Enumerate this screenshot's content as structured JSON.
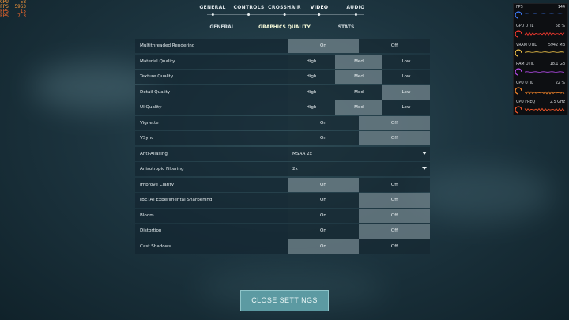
{
  "osd": [
    {
      "k": "GPU",
      "v": "58",
      "color": "#ff9b3a"
    },
    {
      "k": "FPS",
      "v": "5963",
      "color": "#ff9b3a"
    },
    {
      "k": "FPS",
      "v": "15",
      "color": "#ff6a2a"
    },
    {
      "k": "FPS",
      "v": "7.3",
      "color": "#ff6a2a"
    }
  ],
  "tabs": [
    "GENERAL",
    "CONTROLS",
    "CROSSHAIR",
    "VIDEO",
    "AUDIO"
  ],
  "active_tab": "VIDEO",
  "subtabs": [
    "GENERAL",
    "GRAPHICS QUALITY",
    "STATS"
  ],
  "active_subtab": "GRAPHICS QUALITY",
  "settings": [
    {
      "label": "Multithreaded Rendering",
      "options": [
        "On",
        "Off"
      ],
      "selected": 0
    },
    {
      "label": "Material Quality",
      "options": [
        "High",
        "Med",
        "Low"
      ],
      "selected": 1
    },
    {
      "label": "Texture Quality",
      "options": [
        "High",
        "Med",
        "Low"
      ],
      "selected": 1
    },
    {
      "label": "Detail Quality",
      "options": [
        "High",
        "Med",
        "Low"
      ],
      "selected": 2
    },
    {
      "label": "UI Quality",
      "options": [
        "High",
        "Med",
        "Low"
      ],
      "selected": 1
    },
    {
      "label": "Vignette",
      "options": [
        "On",
        "Off"
      ],
      "selected": 1
    },
    {
      "label": "VSync",
      "options": [
        "On",
        "Off"
      ],
      "selected": 1
    },
    {
      "label": "Anti-Aliasing",
      "dropdown": "MSAA 2x"
    },
    {
      "label": "Anisotropic Filtering",
      "dropdown": "2x"
    },
    {
      "label": "Improve Clarity",
      "options": [
        "On",
        "Off"
      ],
      "selected": 0
    },
    {
      "label": "[BETA] Experimental Sharpening",
      "options": [
        "On",
        "Off"
      ],
      "selected": 1
    },
    {
      "label": "Bloom",
      "options": [
        "On",
        "Off"
      ],
      "selected": 1
    },
    {
      "label": "Distortion",
      "options": [
        "On",
        "Off"
      ],
      "selected": 1
    },
    {
      "label": "Cast Shadows",
      "options": [
        "On",
        "Off"
      ],
      "selected": 0
    }
  ],
  "close_label": "CLOSE SETTINGS",
  "monitor": [
    {
      "name": "FPS",
      "value": "144",
      "color": "#3f7fff",
      "level": 0.9
    },
    {
      "name": "GPU UTIL",
      "value": "58 %",
      "color": "#ff3b30",
      "level": 0.58
    },
    {
      "name": "VRAM UTIL",
      "value": "5942 MB",
      "color": "#f6c84a",
      "level": 0.72
    },
    {
      "name": "RAM UTIL",
      "value": "18.1 GB",
      "color": "#b84cf0",
      "level": 0.56
    },
    {
      "name": "CPU UTIL",
      "value": "22 %",
      "color": "#ff8a2a",
      "level": 0.22
    },
    {
      "name": "CPU FREQ",
      "value": "2.5 GHz",
      "color": "#ff5a2a",
      "level": 0.6
    }
  ]
}
